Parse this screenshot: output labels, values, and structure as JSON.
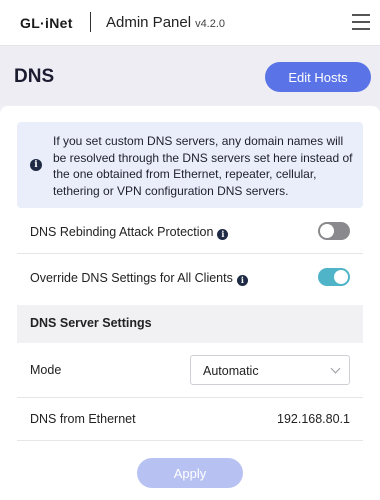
{
  "header": {
    "logo": "GL·iNet",
    "title": "Admin Panel",
    "version": "v4.2.0",
    "menu_icon": "hamburger-menu-icon"
  },
  "page": {
    "title": "DNS",
    "edit_hosts_label": "Edit Hosts"
  },
  "info": {
    "icon": "info-icon",
    "text": "If you set custom DNS servers, any domain names will be resolved through the DNS servers set here instead of the one obtained from Ethernet, repeater, cellular, tethering or VPN configuration DNS servers."
  },
  "settings": {
    "rebinding_label": "DNS Rebinding Attack Protection",
    "rebinding_enabled": false,
    "override_label": "Override DNS Settings for All Clients",
    "override_enabled": true
  },
  "server_settings": {
    "section_title": "DNS Server Settings",
    "mode_label": "Mode",
    "mode_value": "Automatic",
    "ethernet_label": "DNS from Ethernet",
    "ethernet_value": "192.168.80.1"
  },
  "actions": {
    "apply_label": "Apply"
  },
  "colors": {
    "accent": "#5a73e6",
    "toggle_on": "#4fb4c8",
    "toggle_off": "#8a8a8e",
    "apply_disabled": "#b7c2f3",
    "info_bg": "#e9eefa"
  }
}
